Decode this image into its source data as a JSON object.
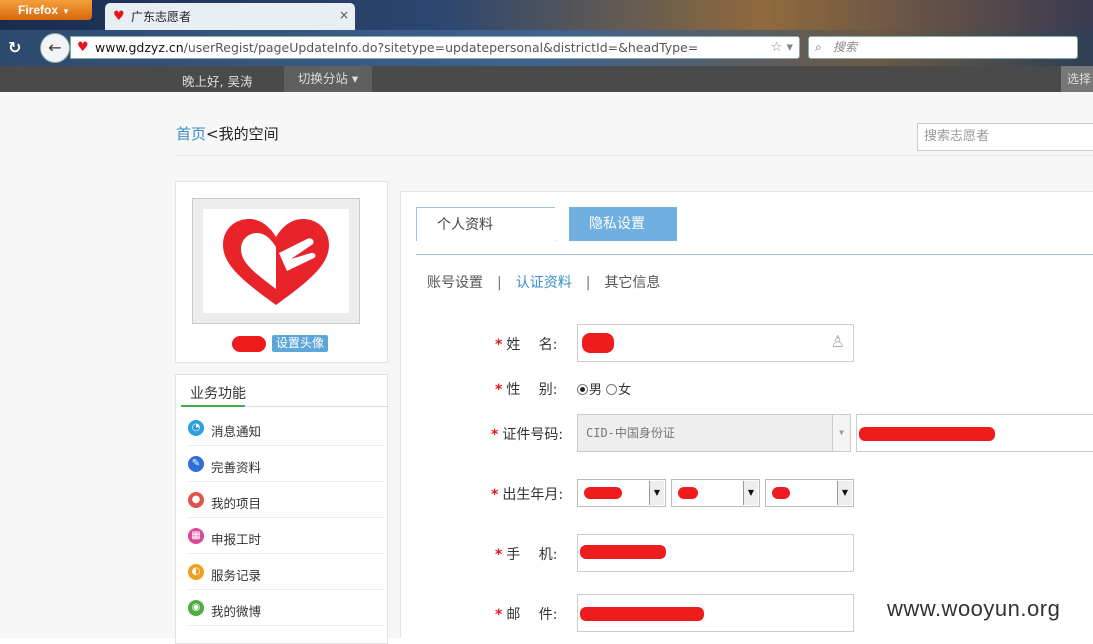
{
  "browser": {
    "app_button": "Firefox",
    "tab_title": "广东志愿者",
    "tab_close": "×",
    "url_host": "www.gdzyz.cn",
    "url_path": "/userRegist/pageUpdateInfo.do?sitetype=updatepersonal&districtId=&headType=",
    "search_placeholder": "搜索"
  },
  "sitebar": {
    "greeting": "晚上好, 吴涛",
    "switch_label": "切换分站",
    "right_label": "选择"
  },
  "header": {
    "breadcrumb_home": "首页",
    "breadcrumb_sep": "<",
    "breadcrumb_current": "我的空间",
    "search_placeholder": "搜索志愿者"
  },
  "profile": {
    "set_avatar_label": "设置头像"
  },
  "functions": {
    "title": "业务功能",
    "items": [
      {
        "label": "消息通知",
        "icon": "message-icon",
        "color": "#2aa0dc"
      },
      {
        "label": "完善资料",
        "icon": "edit-icon",
        "color": "#2e6fd8"
      },
      {
        "label": "我的项目",
        "icon": "project-icon",
        "color": "#e0524a"
      },
      {
        "label": "申报工时",
        "icon": "calendar-icon",
        "color": "#d84a9a"
      },
      {
        "label": "服务记录",
        "icon": "record-icon",
        "color": "#f0a020"
      },
      {
        "label": "我的微博",
        "icon": "weibo-icon",
        "color": "#4cae3c"
      }
    ]
  },
  "tabs": {
    "personal": "个人资料",
    "privacy": "隐私设置"
  },
  "subnav": {
    "account": "账号设置",
    "verify": "认证资料",
    "other": "其它信息",
    "sep": "|"
  },
  "form": {
    "required_mark": "*",
    "name_label": "姓　 名:",
    "gender_label": "性　 别:",
    "gender_male": "男",
    "gender_female": "女",
    "id_label": "证件号码:",
    "id_type_value": "CID-中国身份证",
    "birth_label": "出生年月:",
    "phone_label": "手　 机:",
    "email_label": "邮　 件:"
  },
  "watermark": "www.wooyun.org",
  "colors": {
    "accent": "#3a8fc6",
    "required": "#e01818",
    "redaction": "#ee1c1c",
    "tab_active_bg": "#6fb0e0"
  }
}
